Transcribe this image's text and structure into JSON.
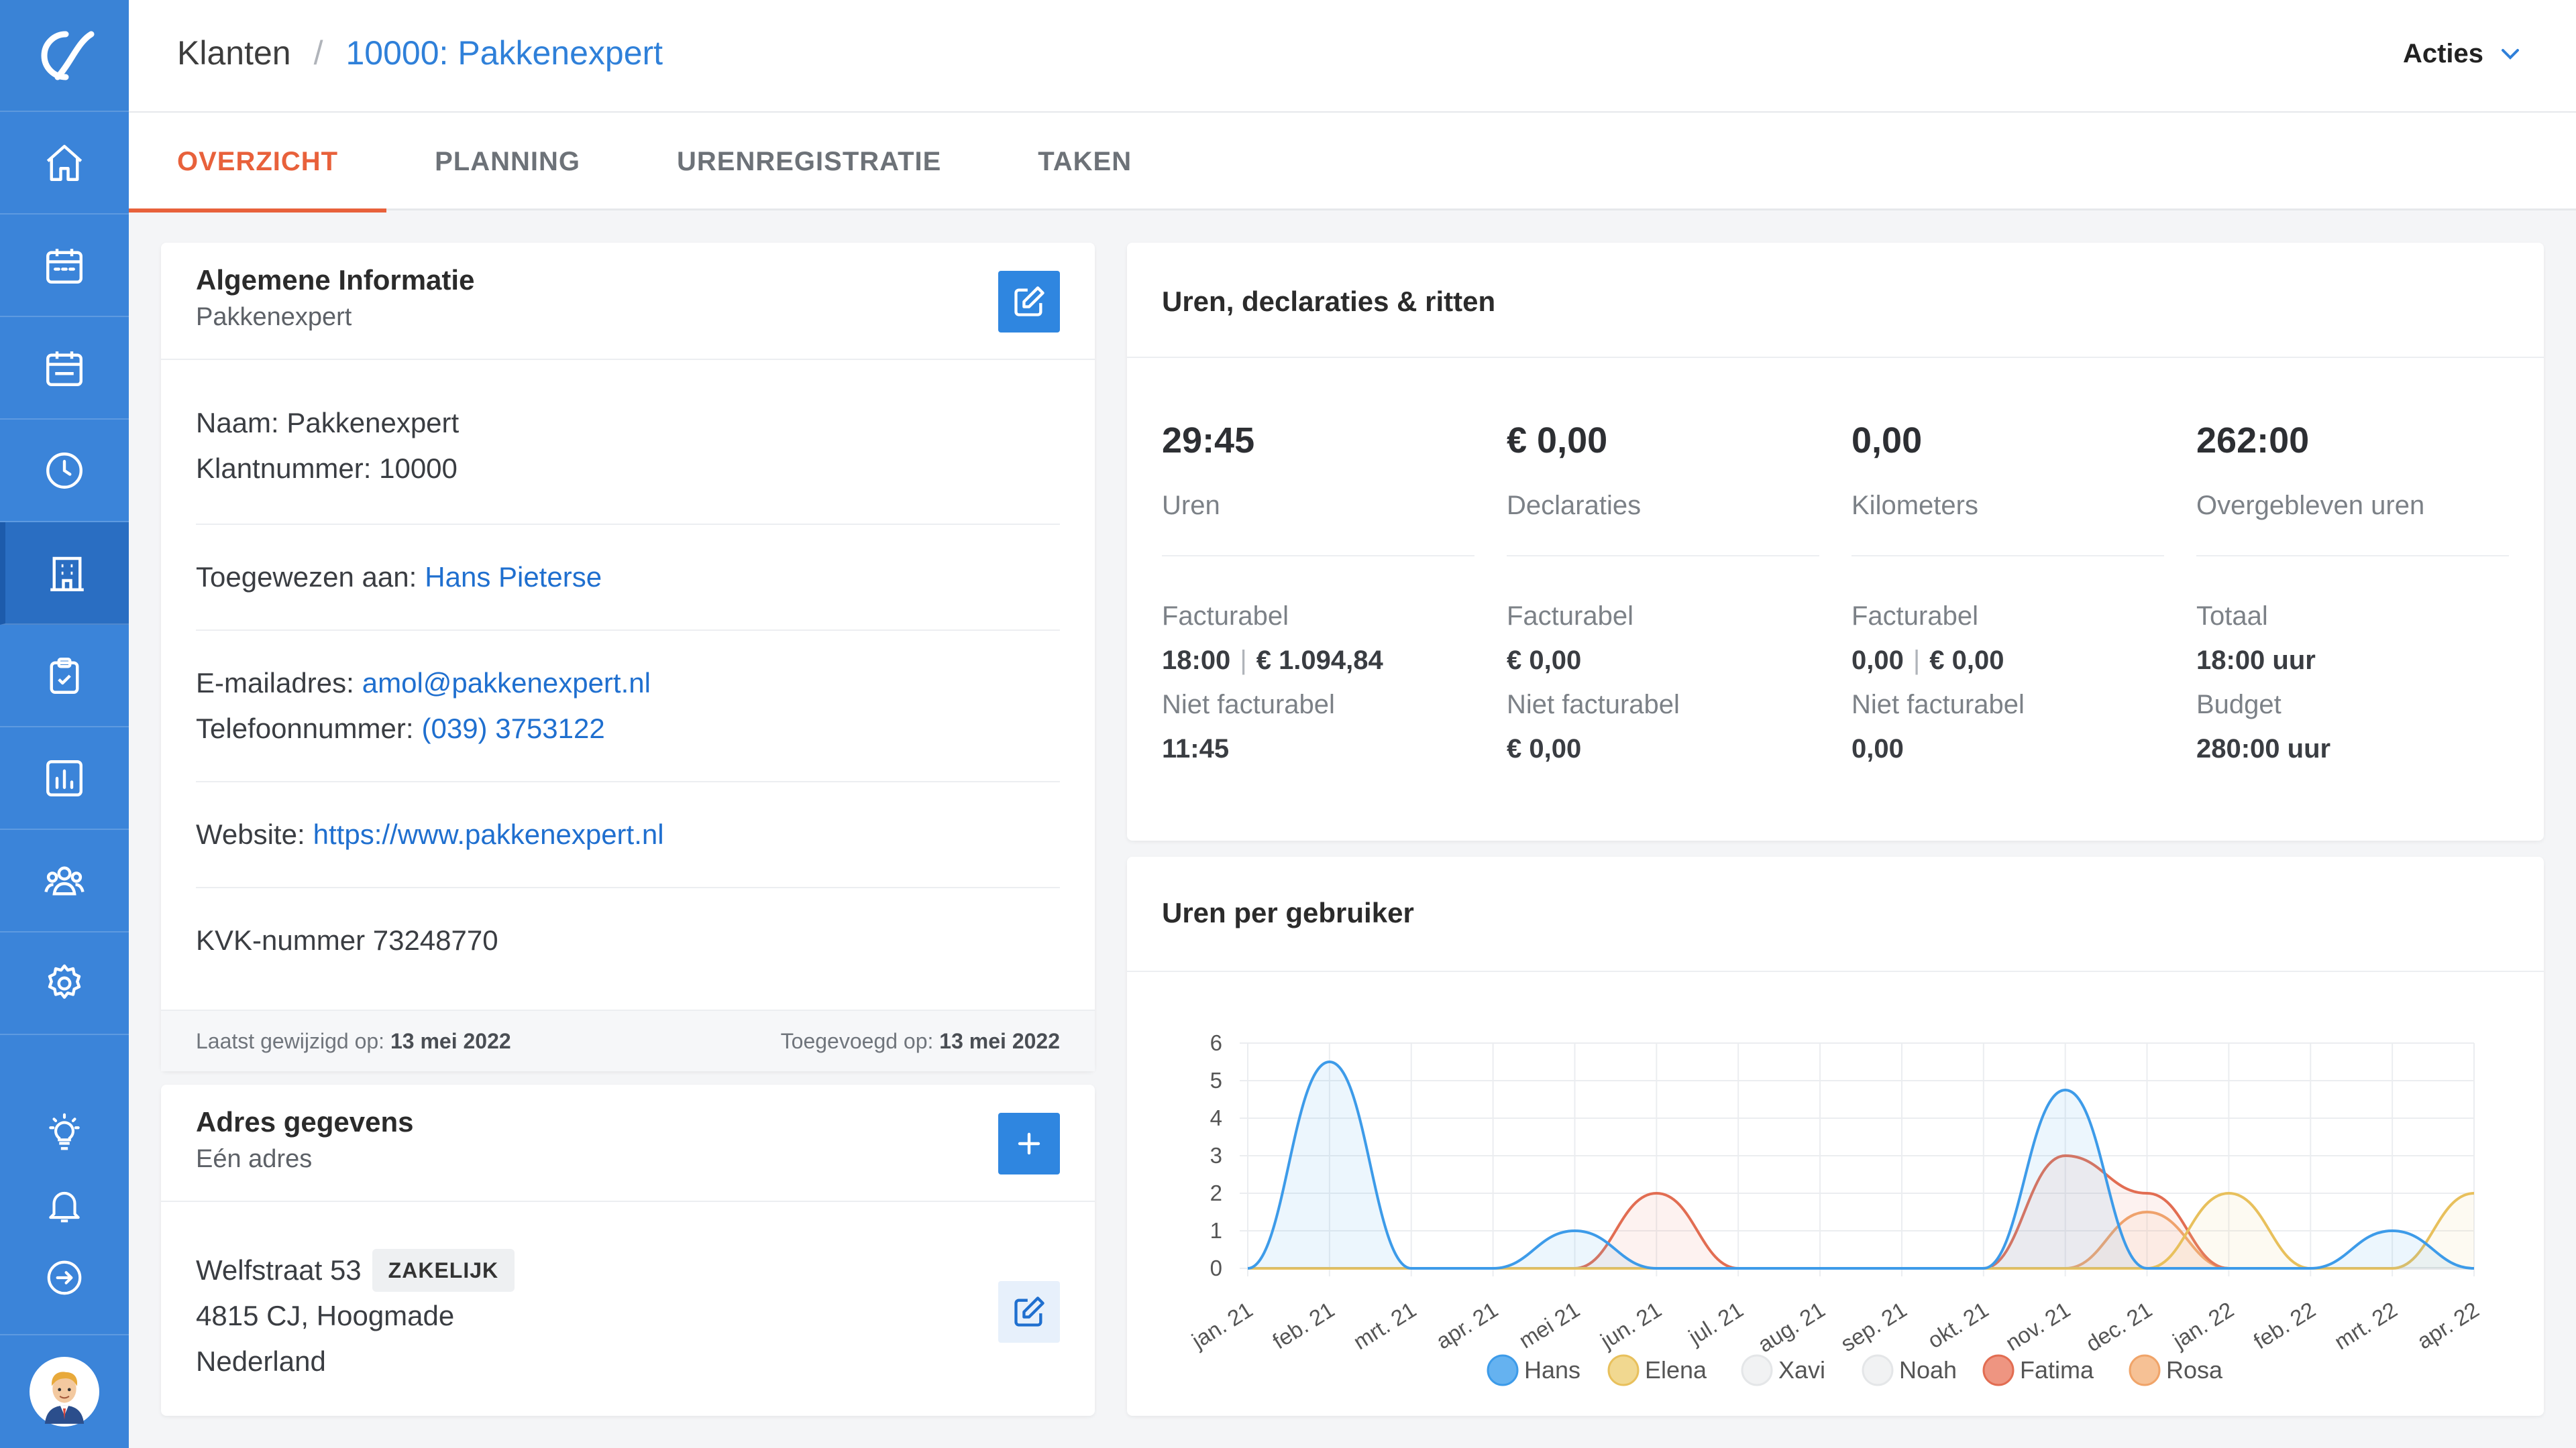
{
  "header": {
    "breadcrumb_root": "Klanten",
    "breadcrumb_sep": "/",
    "breadcrumb_current": "10000: Pakkenexpert",
    "actions_label": "Acties"
  },
  "tabs": [
    {
      "label": "OVERZICHT",
      "active": true
    },
    {
      "label": "PLANNING",
      "active": false
    },
    {
      "label": "URENREGISTRATIE",
      "active": false
    },
    {
      "label": "TAKEN",
      "active": false
    }
  ],
  "sidebar": {
    "items": [
      {
        "icon": "home-icon"
      },
      {
        "icon": "calendar-icon"
      },
      {
        "icon": "calendar-icon"
      },
      {
        "icon": "clock-icon"
      },
      {
        "icon": "building-icon",
        "active": true
      },
      {
        "icon": "clipboard-check-icon"
      },
      {
        "icon": "bar-chart-icon"
      },
      {
        "icon": "users-icon"
      },
      {
        "icon": "gear-icon"
      }
    ],
    "bottom": [
      {
        "icon": "lightbulb-icon"
      },
      {
        "icon": "bell-icon"
      },
      {
        "icon": "arrow-right-circle-icon"
      }
    ]
  },
  "info": {
    "title": "Algemene Informatie",
    "subtitle": "Pakkenexpert",
    "naam_label": "Naam:",
    "naam_value": "Pakkenexpert",
    "klantnummer_label": "Klantnummer:",
    "klantnummer_value": "10000",
    "assigned_label": "Toegewezen aan:",
    "assigned_value": "Hans Pieterse",
    "email_label": "E-mailadres:",
    "email_value": "amol@pakkenexpert.nl",
    "phone_label": "Telefoonnummer:",
    "phone_value": "(039) 3753122",
    "website_label": "Website:",
    "website_value": "https://www.pakkenexpert.nl",
    "kvk_label": "KVK-nummer",
    "kvk_value": "73248770",
    "modified_label": "Laatst gewijzigd op:",
    "modified_value": "13 mei 2022",
    "added_label": "Toegevoegd op:",
    "added_value": "13 mei 2022"
  },
  "address": {
    "title": "Adres gegevens",
    "subtitle": "Eén adres",
    "street": "Welfstraat 53",
    "badge": "ZAKELIJK",
    "city": "4815 CJ, Hoogmade",
    "country": "Nederland"
  },
  "stats": {
    "title": "Uren, declaraties & ritten",
    "columns": [
      {
        "big": "29:45",
        "label": "Uren",
        "k1": "Facturabel",
        "v1a": "18:00",
        "v1b": "€ 1.094,84",
        "k2": "Niet facturabel",
        "v2": "11:45"
      },
      {
        "big": "€ 0,00",
        "label": "Declaraties",
        "k1": "Facturabel",
        "v1a": "€ 0,00",
        "v1b": "",
        "k2": "Niet facturabel",
        "v2": "€ 0,00"
      },
      {
        "big": "0,00",
        "label": "Kilometers",
        "k1": "Facturabel",
        "v1a": "0,00",
        "v1b": "€ 0,00",
        "k2": "Niet facturabel",
        "v2": "0,00"
      },
      {
        "big": "262:00",
        "label": "Overgebleven uren",
        "k1": "Totaal",
        "v1a": "18:00 uur",
        "v1b": "",
        "k2": "Budget",
        "v2": "280:00 uur"
      }
    ]
  },
  "chart_title": "Uren per gebruiker",
  "chart_data": {
    "type": "area",
    "categories": [
      "jan. 21",
      "feb. 21",
      "mrt. 21",
      "apr. 21",
      "mei 21",
      "jun. 21",
      "jul. 21",
      "aug. 21",
      "sep. 21",
      "okt. 21",
      "nov. 21",
      "dec. 21",
      "jan. 22",
      "feb. 22",
      "mrt. 22",
      "apr. 22"
    ],
    "ylim": [
      0,
      6
    ],
    "yticks": [
      "0",
      "1",
      "2",
      "3",
      "4",
      "5",
      "6"
    ],
    "legend_position": "bottom",
    "grid": true,
    "series": [
      {
        "name": "Hans",
        "color": "#3d9be9",
        "fill": "#65b2f0",
        "values": [
          0,
          5.5,
          0,
          0,
          1,
          0,
          0,
          0,
          0,
          0,
          4.75,
          0,
          0,
          0,
          1,
          0
        ]
      },
      {
        "name": "Elena",
        "color": "#e8c05c",
        "fill": "#f1d890",
        "values": [
          0,
          0,
          0,
          0,
          0,
          0,
          0,
          0,
          0,
          0,
          0,
          0,
          2,
          0,
          0,
          2
        ]
      },
      {
        "name": "Xavi",
        "color": "#e4e6e8",
        "fill": "#f1f2f3",
        "values": [
          0,
          0,
          0,
          0,
          0,
          0,
          0,
          0,
          0,
          0,
          0,
          0,
          0,
          0,
          0,
          0
        ]
      },
      {
        "name": "Noah",
        "color": "#e4e6e8",
        "fill": "#f1f2f3",
        "values": [
          0,
          0,
          0,
          0,
          0,
          0,
          0,
          0,
          0,
          0,
          0,
          0,
          0,
          0,
          0,
          0
        ]
      },
      {
        "name": "Fatima",
        "color": "#e26d52",
        "fill": "#ee9581",
        "values": [
          0,
          0,
          0,
          0,
          0,
          2,
          0,
          0,
          0,
          0,
          3,
          2,
          0,
          0,
          0,
          0
        ]
      },
      {
        "name": "Rosa",
        "color": "#f0a469",
        "fill": "#f6c195",
        "values": [
          0,
          0,
          0,
          0,
          0,
          0,
          0,
          0,
          0,
          0,
          0,
          1.5,
          0,
          0,
          0,
          0
        ]
      }
    ]
  }
}
